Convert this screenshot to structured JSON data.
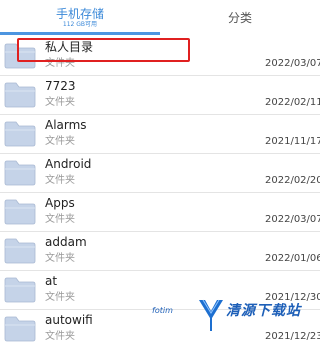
{
  "tabs": {
    "storage": {
      "label": "手机存储",
      "available": "112 GB可用"
    },
    "category": {
      "label": "分类"
    }
  },
  "files": [
    {
      "name": "私人目录",
      "type": "文件夹",
      "date": "2022/03/07"
    },
    {
      "name": "7723",
      "type": "文件夹",
      "date": "2022/02/11"
    },
    {
      "name": "Alarms",
      "type": "文件夹",
      "date": "2021/11/17"
    },
    {
      "name": "Android",
      "type": "文件夹",
      "date": "2022/02/20"
    },
    {
      "name": "Apps",
      "type": "文件夹",
      "date": "2022/03/07"
    },
    {
      "name": "addam",
      "type": "文件夹",
      "date": "2022/01/06"
    },
    {
      "name": "at",
      "type": "文件夹",
      "date": "2021/12/30"
    },
    {
      "name": "autowifi",
      "type": "文件夹",
      "date": "2021/12/23"
    }
  ],
  "watermark": {
    "brand": "清源下载站",
    "site": "fotim"
  },
  "colors": {
    "accent": "#4d95e0",
    "highlight": "#e02020",
    "folder": "#c5d3e8"
  },
  "icons": {
    "folder": "folder-icon"
  }
}
